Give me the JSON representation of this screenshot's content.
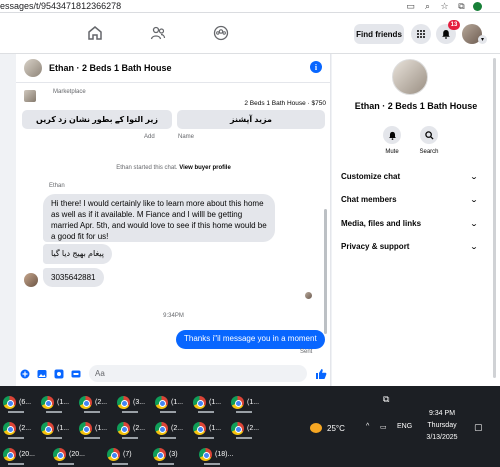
{
  "browser": {
    "url": "essages/t/9543471812366278"
  },
  "fb": {
    "find_friends": "Find friends",
    "notification_count": "13"
  },
  "chat": {
    "title": "Ethan · 2 Beds 1 Bath House",
    "marketplace_label": "Marketplace",
    "listing": "2 Beds 1 Bath House · $750",
    "btn_more_options": "مزید آپشنز",
    "btn_mark_pending": "زیر التوا کے بطور نشان زد کریں",
    "sub_labels": [
      "Add",
      "Name"
    ],
    "started_text": "Ethan started this chat.",
    "view_buyer_profile": "View buyer profile",
    "sender_name": "Ethan",
    "messages": [
      "Hi there! I would certainly like to learn more about this home as well as if it available. M Fiance and I willl be getting married Apr. 5th, and would love to see if this home would be a good fit for us!",
      "پیغام بھیج دیا گیا",
      "3035642881"
    ],
    "timestamp": "9:34PM",
    "my_message": "Thanks i\"il message you in a moment",
    "sent_status": "Sent",
    "input_placeholder": "Aa"
  },
  "details": {
    "name": "Ethan · 2 Beds 1 Bath House",
    "mute": "Mute",
    "search": "Search",
    "sections": [
      "Customize chat",
      "Chat members",
      "Media, files and links",
      "Privacy & support"
    ]
  },
  "taskbar": {
    "row1": [
      "(6...",
      "(1...",
      "(2...",
      "(3...",
      "(1...",
      "(1...",
      "(1..."
    ],
    "row2": [
      "(2...",
      "(1...",
      "(1...",
      "(2...",
      "(2...",
      "(1...",
      "(2..."
    ],
    "row3": [
      "(20...",
      "(20...",
      "(7)",
      "(3)",
      "(18)..."
    ],
    "temperature": "25°C",
    "language": "ENG",
    "time": "9:34 PM",
    "day": "Thursday",
    "date": "3/13/2025"
  },
  "colors": {
    "accent": "#0866ff",
    "badge": "#e41e3f",
    "bubble": "#e4e6eb",
    "taskbar": "#1c1f24"
  }
}
